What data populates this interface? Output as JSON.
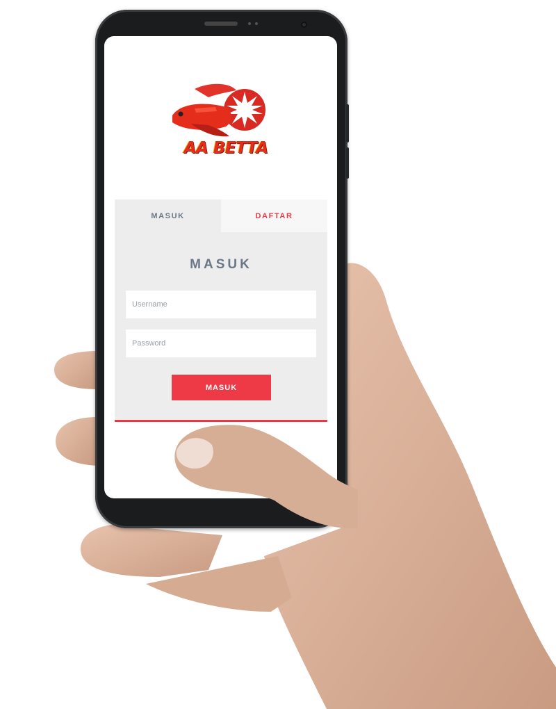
{
  "app": {
    "logo_text": "AA BETTA"
  },
  "tabs": [
    {
      "label": "MASUK",
      "active": true
    },
    {
      "label": "DAFTAR",
      "active": false
    }
  ],
  "form": {
    "heading": "MASUK",
    "username_placeholder": "Username",
    "password_placeholder": "Password",
    "submit_label": "MASUK"
  },
  "colors": {
    "accent": "#ed3a46",
    "heading": "#6a7787",
    "card_bg": "#ededed"
  }
}
